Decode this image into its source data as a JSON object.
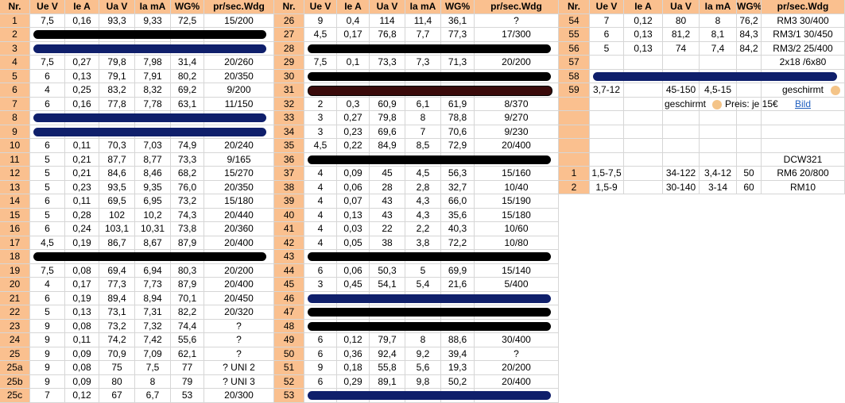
{
  "headers": [
    "Nr.",
    "Ue V",
    "Ie A",
    "Ua V",
    "Ia mA",
    "WG%",
    "pr/sec.Wdg"
  ],
  "left_rows": [
    {
      "nr": "1",
      "v": [
        "7,5",
        "0,16",
        "93,3",
        "9,33",
        "72,5",
        "15/200"
      ]
    },
    {
      "nr": "2",
      "bar": "black"
    },
    {
      "nr": "3",
      "bar": "navy"
    },
    {
      "nr": "4",
      "v": [
        "7,5",
        "0,27",
        "79,8",
        "7,98",
        "31,4",
        "20/260"
      ]
    },
    {
      "nr": "5",
      "v": [
        "6",
        "0,13",
        "79,1",
        "7,91",
        "80,2",
        "20/350"
      ]
    },
    {
      "nr": "6",
      "v": [
        "4",
        "0,25",
        "83,2",
        "8,32",
        "69,2",
        "9/200"
      ]
    },
    {
      "nr": "7",
      "v": [
        "6",
        "0,16",
        "77,8",
        "7,78",
        "63,1",
        "11/150"
      ]
    },
    {
      "nr": "8",
      "bar": "navy"
    },
    {
      "nr": "9",
      "bar": "navy"
    },
    {
      "nr": "10",
      "v": [
        "6",
        "0,11",
        "70,3",
        "7,03",
        "74,9",
        "20/240"
      ]
    },
    {
      "nr": "11",
      "v": [
        "5",
        "0,21",
        "87,7",
        "8,77",
        "73,3",
        "9/165"
      ]
    },
    {
      "nr": "12",
      "v": [
        "5",
        "0,21",
        "84,6",
        "8,46",
        "68,2",
        "15/270"
      ]
    },
    {
      "nr": "13",
      "v": [
        "5",
        "0,23",
        "93,5",
        "9,35",
        "76,0",
        "20/350"
      ]
    },
    {
      "nr": "14",
      "v": [
        "6",
        "0,11",
        "69,5",
        "6,95",
        "73,2",
        "15/180"
      ]
    },
    {
      "nr": "15",
      "v": [
        "5",
        "0,28",
        "102",
        "10,2",
        "74,3",
        "20/440"
      ]
    },
    {
      "nr": "16",
      "v": [
        "6",
        "0,24",
        "103,1",
        "10,31",
        "73,8",
        "20/360"
      ]
    },
    {
      "nr": "17",
      "v": [
        "4,5",
        "0,19",
        "86,7",
        "8,67",
        "87,9",
        "20/400"
      ]
    },
    {
      "nr": "18",
      "bar": "black"
    },
    {
      "nr": "19",
      "v": [
        "7,5",
        "0,08",
        "69,4",
        "6,94",
        "80,3",
        "20/200"
      ]
    },
    {
      "nr": "20",
      "v": [
        "4",
        "0,17",
        "77,3",
        "7,73",
        "87,9",
        "20/400"
      ]
    },
    {
      "nr": "21",
      "v": [
        "6",
        "0,19",
        "89,4",
        "8,94",
        "70,1",
        "20/450"
      ]
    },
    {
      "nr": "22",
      "v": [
        "5",
        "0,13",
        "73,1",
        "7,31",
        "82,2",
        "20/320"
      ]
    },
    {
      "nr": "23",
      "v": [
        "9",
        "0,08",
        "73,2",
        "7,32",
        "74,4",
        "?"
      ]
    },
    {
      "nr": "24",
      "v": [
        "9",
        "0,11",
        "74,2",
        "7,42",
        "55,6",
        "?"
      ]
    },
    {
      "nr": "25",
      "v": [
        "9",
        "0,09",
        "70,9",
        "7,09",
        "62,1",
        "?"
      ]
    },
    {
      "nr": "25a",
      "v": [
        "9",
        "0,08",
        "75",
        "7,5",
        "77",
        "? UNI 2"
      ]
    },
    {
      "nr": "25b",
      "v": [
        "9",
        "0,09",
        "80",
        "8",
        "79",
        "? UNI 3"
      ]
    },
    {
      "nr": "25c",
      "v": [
        "7",
        "0,12",
        "67",
        "6,7",
        "53",
        "20/300"
      ]
    }
  ],
  "mid_rows": [
    {
      "nr": "26",
      "v": [
        "9",
        "0,4",
        "114",
        "11,4",
        "36,1",
        "?"
      ]
    },
    {
      "nr": "27",
      "v": [
        "4,5",
        "0,17",
        "76,8",
        "7,7",
        "77,3",
        "17/300"
      ]
    },
    {
      "nr": "28",
      "bar": "black"
    },
    {
      "nr": "29",
      "v": [
        "7,5",
        "0,1",
        "73,3",
        "7,3",
        "71,3",
        "20/200"
      ]
    },
    {
      "nr": "30",
      "bar": "black"
    },
    {
      "nr": "31",
      "bar": "maroon"
    },
    {
      "nr": "32",
      "v": [
        "2",
        "0,3",
        "60,9",
        "6,1",
        "61,9",
        "8/370"
      ]
    },
    {
      "nr": "33",
      "v": [
        "3",
        "0,27",
        "79,8",
        "8",
        "78,8",
        "9/270"
      ]
    },
    {
      "nr": "34",
      "v": [
        "3",
        "0,23",
        "69,6",
        "7",
        "70,6",
        "9/230"
      ]
    },
    {
      "nr": "35",
      "v": [
        "4,5",
        "0,22",
        "84,9",
        "8,5",
        "72,9",
        "20/400"
      ]
    },
    {
      "nr": "36",
      "bar": "black"
    },
    {
      "nr": "37",
      "v": [
        "4",
        "0,09",
        "45",
        "4,5",
        "56,3",
        "15/160"
      ]
    },
    {
      "nr": "38",
      "v": [
        "4",
        "0,06",
        "28",
        "2,8",
        "32,7",
        "10/40"
      ]
    },
    {
      "nr": "39",
      "v": [
        "4",
        "0,07",
        "43",
        "4,3",
        "66,0",
        "15/190"
      ]
    },
    {
      "nr": "40",
      "v": [
        "4",
        "0,13",
        "43",
        "4,3",
        "35,6",
        "15/180"
      ]
    },
    {
      "nr": "41",
      "v": [
        "4",
        "0,03",
        "22",
        "2,2",
        "40,3",
        "10/60"
      ]
    },
    {
      "nr": "42",
      "v": [
        "4",
        "0,05",
        "38",
        "3,8",
        "72,2",
        "10/80"
      ]
    },
    {
      "nr": "43",
      "bar": "black"
    },
    {
      "nr": "44",
      "v": [
        "6",
        "0,06",
        "50,3",
        "5",
        "69,9",
        "15/140"
      ]
    },
    {
      "nr": "45",
      "v": [
        "3",
        "0,45",
        "54,1",
        "5,4",
        "21,6",
        "5/400"
      ]
    },
    {
      "nr": "46",
      "bar": "navy"
    },
    {
      "nr": "47",
      "bar": "black"
    },
    {
      "nr": "48",
      "bar": "black"
    },
    {
      "nr": "49",
      "v": [
        "6",
        "0,12",
        "79,7",
        "8",
        "88,6",
        "30/400"
      ]
    },
    {
      "nr": "50",
      "v": [
        "6",
        "0,36",
        "92,4",
        "9,2",
        "39,4",
        "?"
      ]
    },
    {
      "nr": "51",
      "v": [
        "9",
        "0,18",
        "55,8",
        "5,6",
        "19,3",
        "20/200"
      ]
    },
    {
      "nr": "52",
      "v": [
        "6",
        "0,29",
        "89,1",
        "9,8",
        "50,2",
        "20/400"
      ]
    },
    {
      "nr": "53",
      "bar": "navy"
    }
  ],
  "right_rows": [
    {
      "nr": "54",
      "v": [
        "7",
        "0,12",
        "80",
        "8",
        "76,2",
        "RM3 30/400"
      ]
    },
    {
      "nr": "55",
      "v": [
        "6",
        "0,13",
        "81,2",
        "8,1",
        "84,3",
        "RM3/1 30/450"
      ]
    },
    {
      "nr": "56",
      "v": [
        "5",
        "0,13",
        "74",
        "7,4",
        "84,2",
        "RM3/2 25/400"
      ]
    },
    {
      "nr": "57",
      "v": [
        "",
        "",
        "",
        "",
        "",
        "2x18 /6x80"
      ]
    },
    {
      "nr": "58",
      "bar": "navy"
    },
    {
      "nr": "59",
      "v": [
        "3,7-12",
        "",
        "45-150",
        "4,5-15",
        "",
        "geschirmt"
      ]
    },
    {
      "nr": "",
      "extra": true
    },
    {
      "nr": "",
      "v": [
        "",
        "",
        "",
        "",
        "",
        ""
      ]
    },
    {
      "nr": "",
      "v": [
        "",
        "",
        "",
        "",
        "",
        ""
      ]
    },
    {
      "nr": "",
      "v": [
        "",
        "",
        "",
        "",
        "",
        ""
      ]
    },
    {
      "nr": "",
      "v": [
        "",
        "",
        "",
        "",
        "",
        "DCW321"
      ]
    },
    {
      "nr": "1",
      "v": [
        "1,5-7,5",
        "",
        "34-122",
        "3,4-12",
        "50",
        "RM6 20/800"
      ]
    },
    {
      "nr": "2",
      "v": [
        "1,5-9",
        "",
        "30-140",
        "3-14",
        "60",
        "RM10"
      ]
    }
  ],
  "notes": {
    "geschirmt": "geschirmt",
    "preis": "Preis: je 15€",
    "bild": "Bild"
  },
  "colors": {
    "header_bg": "#fac08f",
    "bar_black": "#000000",
    "bar_navy": "#0f1f6b",
    "bar_maroon": "#3a0a0a",
    "link": "#1f5fbf"
  }
}
